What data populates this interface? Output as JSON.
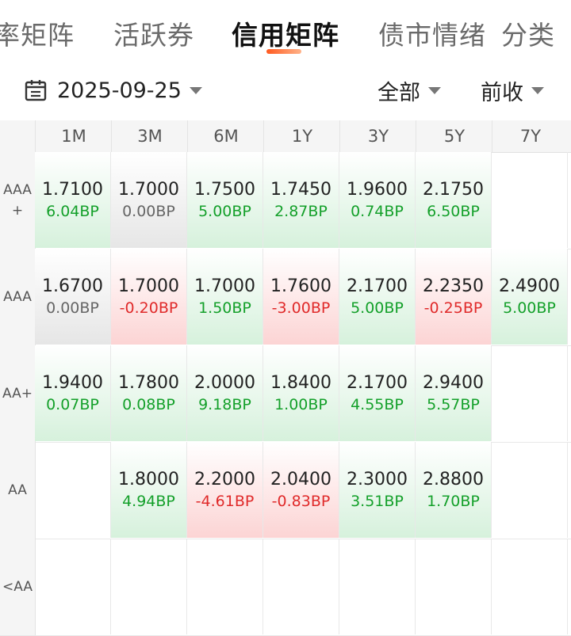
{
  "tabs": [
    {
      "label": "率矩阵"
    },
    {
      "label": "活跃券"
    },
    {
      "label": "信用矩阵"
    },
    {
      "label": "债市情绪"
    },
    {
      "label": "分类"
    }
  ],
  "filters": {
    "date": "2025-09-25",
    "scope": "全部",
    "compare": "前收"
  },
  "columns": [
    "1M",
    "3M",
    "6M",
    "1Y",
    "3Y",
    "5Y",
    "7Y"
  ],
  "rows": [
    {
      "label": "AAA\n+",
      "cells": [
        {
          "value": "1.7100",
          "change": "6.04BP"
        },
        {
          "value": "1.7000",
          "change": "0.00BP"
        },
        {
          "value": "1.7500",
          "change": "5.00BP"
        },
        {
          "value": "1.7450",
          "change": "2.87BP"
        },
        {
          "value": "1.9600",
          "change": "0.74BP"
        },
        {
          "value": "2.1750",
          "change": "6.50BP"
        },
        null
      ]
    },
    {
      "label": "AAA",
      "cells": [
        {
          "value": "1.6700",
          "change": "0.00BP"
        },
        {
          "value": "1.7000",
          "change": "-0.20BP"
        },
        {
          "value": "1.7000",
          "change": "1.50BP"
        },
        {
          "value": "1.7600",
          "change": "-3.00BP"
        },
        {
          "value": "2.1700",
          "change": "5.00BP"
        },
        {
          "value": "2.2350",
          "change": "-0.25BP"
        },
        {
          "value": "2.4900",
          "change": "5.00BP"
        }
      ]
    },
    {
      "label": "AA+",
      "cells": [
        {
          "value": "1.9400",
          "change": "0.07BP"
        },
        {
          "value": "1.7800",
          "change": "0.08BP"
        },
        {
          "value": "2.0000",
          "change": "9.18BP"
        },
        {
          "value": "1.8400",
          "change": "1.00BP"
        },
        {
          "value": "2.1700",
          "change": "4.55BP"
        },
        {
          "value": "2.9400",
          "change": "5.57BP"
        },
        null
      ]
    },
    {
      "label": "AA",
      "cells": [
        null,
        {
          "value": "1.8000",
          "change": "4.94BP"
        },
        {
          "value": "2.2000",
          "change": "-4.61BP"
        },
        {
          "value": "2.0400",
          "change": "-0.83BP"
        },
        {
          "value": "2.3000",
          "change": "3.51BP"
        },
        {
          "value": "2.8800",
          "change": "1.70BP"
        },
        null
      ]
    },
    {
      "label": "<AA",
      "cells": [
        null,
        null,
        null,
        null,
        null,
        null,
        null
      ]
    }
  ]
}
